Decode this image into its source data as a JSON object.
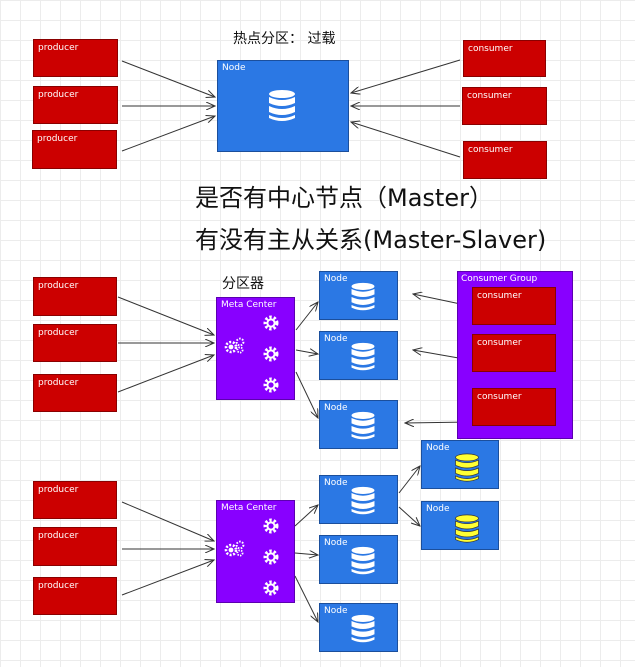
{
  "labels": {
    "hotspot_title": "热点分区： 过载",
    "question_master": "是否有中心节点（Master）",
    "question_master_slaver": "有没有主从关系(Master-Slaver)",
    "partitioner": "分区器"
  },
  "top": {
    "producers": [
      "producer",
      "producer",
      "producer"
    ],
    "node": "Node",
    "consumers": [
      "consumer",
      "consumer",
      "consumer"
    ]
  },
  "middle": {
    "producers": [
      "producer",
      "producer",
      "producer"
    ],
    "meta_center": "Meta Center",
    "nodes": [
      "Node",
      "Node",
      "Node"
    ],
    "consumer_group": {
      "title": "Consumer Group",
      "consumers": [
        "consumer",
        "consumer",
        "consumer"
      ]
    }
  },
  "bottom": {
    "producers": [
      "producer",
      "producer",
      "producer"
    ],
    "meta_center": "Meta Center",
    "nodes": [
      "Node",
      "Node",
      "Node"
    ],
    "replica_nodes": [
      "Node",
      "Node"
    ]
  },
  "colors": {
    "producer": "#cc0000",
    "node": "#2b78e4",
    "meta_center": "#8800ff",
    "replica_db": "#ffff33"
  },
  "icons": {
    "node": "database-icon",
    "meta_center": "gear-icon"
  }
}
